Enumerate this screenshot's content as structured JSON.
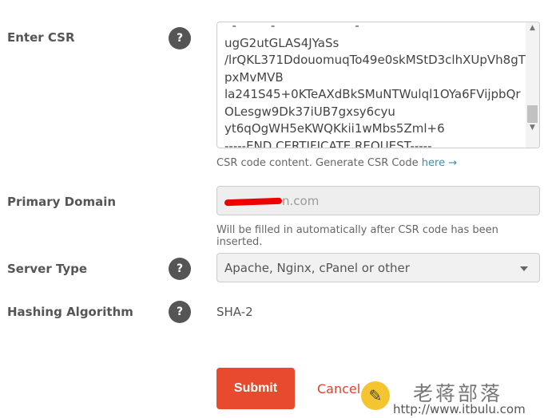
{
  "csr": {
    "label": "Enter CSR",
    "help": "?",
    "lines": [
      "ugG2utGLAS4JYaSs",
      "/lrQKL371DdouomuqTo49e0skMStD3clhXUpVh8gT",
      "pxMvMVB",
      "la241S45+0KTeAXdBkSMuNTWulql1OYa6FVijpbQr",
      "OLesgw9Dk37iUB7gxsy6cyu",
      "yt6qOgWH5eKWQKkii1wMbs5Zml+6",
      "-----END CERTIFICATE REQUEST-----"
    ],
    "hint": "CSR code content. Generate CSR Code",
    "hint_link": "here →"
  },
  "domain": {
    "label": "Primary Domain",
    "value_visible": "n.com",
    "hint": "Will be filled in automatically after CSR code has been inserted."
  },
  "server": {
    "label": "Server Type",
    "help": "?",
    "selected": "Apache, Nginx, cPanel or other"
  },
  "hash": {
    "label": "Hashing Algorithm",
    "help": "?",
    "value": "SHA-2"
  },
  "actions": {
    "submit": "Submit",
    "cancel": "Cancel"
  },
  "watermark": {
    "name": "老蒋部落",
    "url": "http://www.itbulu.com"
  },
  "colors": {
    "submit": "#e84a2e",
    "cancel": "#d9442b",
    "link": "#3a8fa8"
  }
}
